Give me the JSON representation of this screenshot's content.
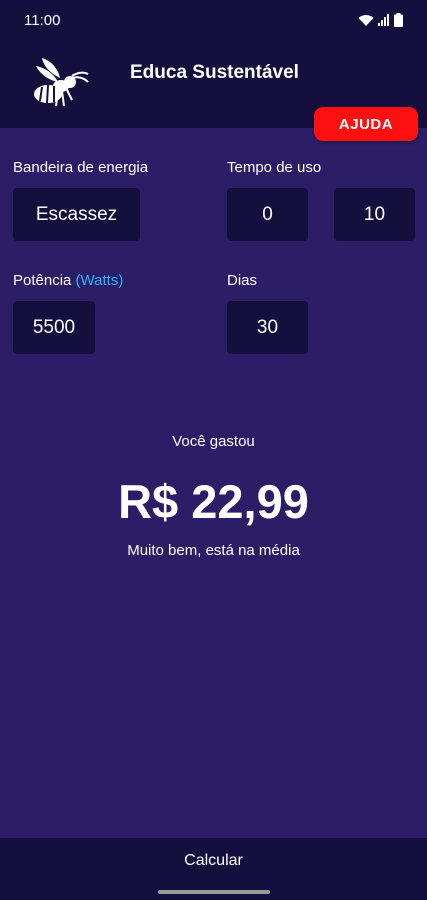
{
  "status_bar": {
    "time": "11:00",
    "icons": [
      "wifi-icon",
      "signal-icon",
      "battery-icon"
    ]
  },
  "app_bar": {
    "title": "Educa Sustentável",
    "logo_icon": "wasp-icon"
  },
  "help_button": {
    "label": "AJUDA"
  },
  "form": {
    "flag_label": "Bandeira de energia",
    "flag_value": "Escassez",
    "usage_label": "Tempo de uso",
    "usage_hours": "0",
    "usage_minutes": "10",
    "power_label": "Potência",
    "power_unit": "(Watts)",
    "power_value": "5500",
    "days_label": "Dias",
    "days_value": "30"
  },
  "result": {
    "caption": "Você gastou",
    "value": "R$ 22,99",
    "message": "Muito bem, está na média"
  },
  "bottom": {
    "calculate_label": "Calcular"
  },
  "colors": {
    "background": "#2b1d66",
    "bar": "#150f3e",
    "accent_link": "#29b6f6",
    "help_button": "#ff1010"
  }
}
